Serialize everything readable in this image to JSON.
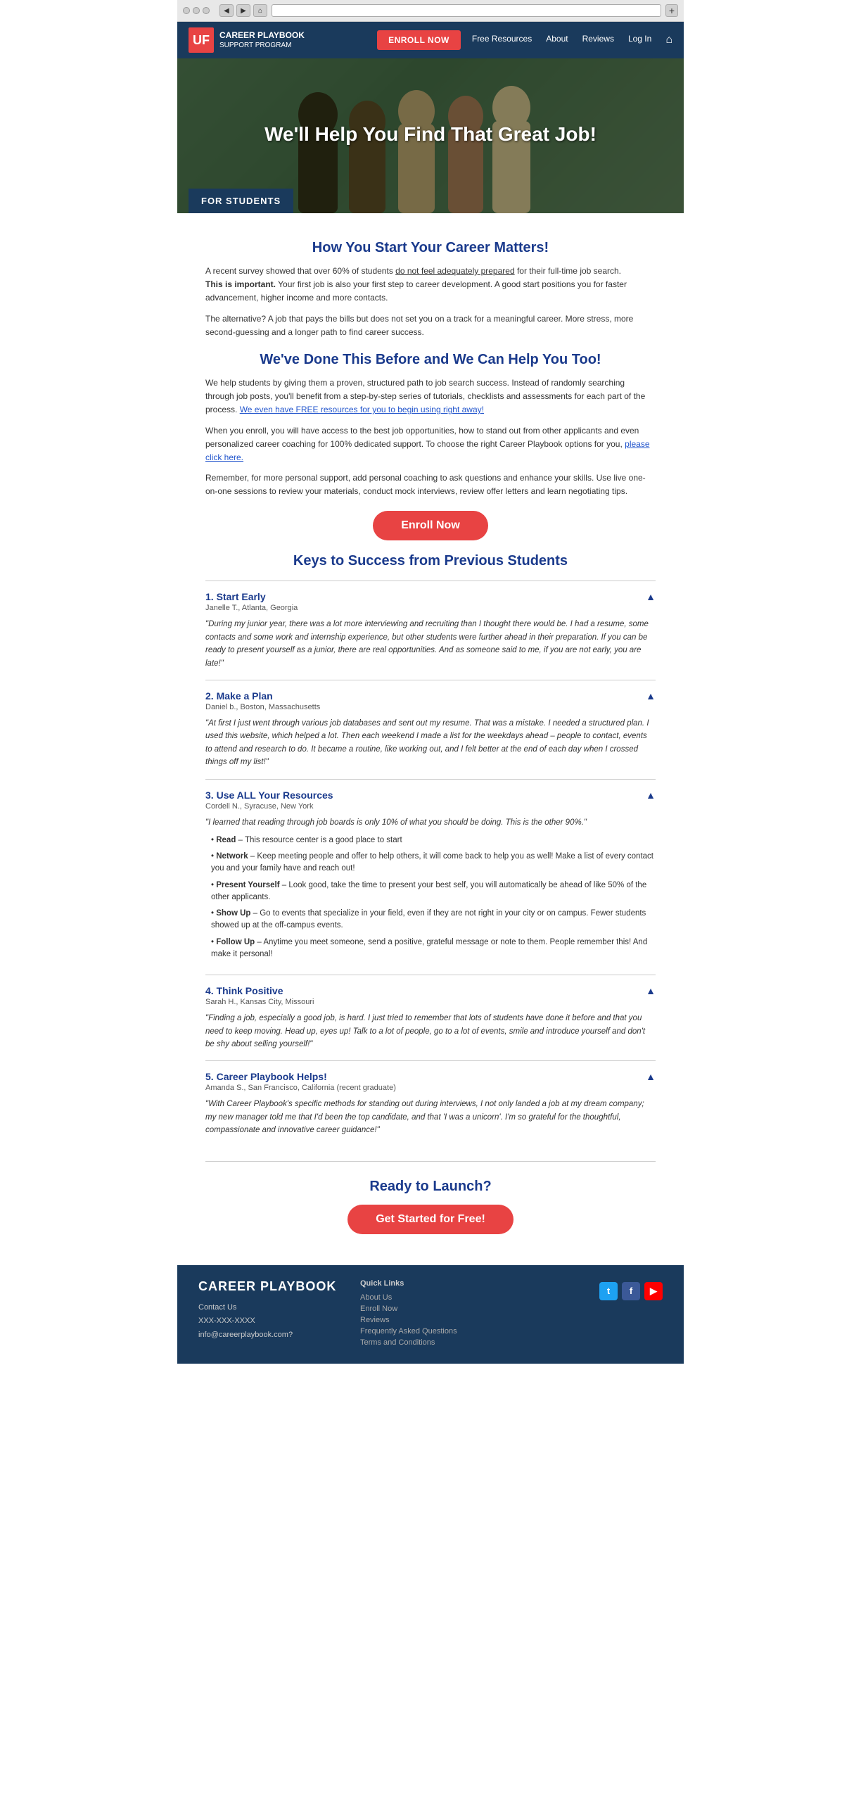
{
  "browser": {
    "address": ""
  },
  "nav": {
    "logo_letters": "UF",
    "logo_line1": "CAREER PLAYBOOK",
    "logo_line2": "SUPPORT PROGRAM",
    "enroll_btn": "ENROLL NOW",
    "links": [
      "Free Resources",
      "About",
      "Reviews",
      "Log In"
    ],
    "home_icon": "⌂"
  },
  "hero": {
    "title": "We'll Help You Find That Great Job!",
    "badge": "FOR STUDENTS"
  },
  "intro": {
    "heading1": "How You Start Your Career Matters!",
    "para1a": "A recent survey showed that over 60% of students ",
    "para1a_underline": "do not feel adequately prepared",
    "para1b": " for their full-time job search.",
    "para2_bold": "This is important.",
    "para2": " Your first job is also your first step to career development. A good start positions you for faster advancement, higher income and more contacts.",
    "para3": "The alternative? A job that pays the bills but does not set you on a track for a meaningful career. More stress, more second-guessing and a longer path to find career success.",
    "heading2": "We've Done This Before and We Can Help You Too!",
    "para4a": "We help students by giving them a proven, structured path to job search success. Instead of randomly searching through job posts, you'll benefit from a step-by-step series of tutorials, checklists and assessments for each part of the process. ",
    "para4_link": "We even have FREE resources for you to begin using right away!",
    "para5a": "When you enroll, you will have access to the best job opportunities, how to stand out from other applicants and even personalized career coaching for 100% dedicated support. To choose the right Career Playbook options for you, ",
    "para5_link": "please click here.",
    "para6": "Remember, for more personal support, add personal coaching to ask questions and enhance your skills. Use live one-on-one sessions to review your materials, conduct mock interviews, review offer letters and learn negotiating tips.",
    "enroll_btn": "Enroll Now"
  },
  "keys": {
    "heading": "Keys to Success from Previous Students",
    "items": [
      {
        "number": "1.",
        "title": "Start Early",
        "person": "Janelle T., Atlanta, Georgia",
        "quote": "\"During my junior year, there was a lot more interviewing and recruiting than I thought there would be. I had a resume, some contacts and some work and internship experience, but other students were further ahead in their preparation. If you can be ready to present yourself as a junior, there are real opportunities. And as someone said to me, if you are not early, you are late!\""
      },
      {
        "number": "2.",
        "title": "Make a Plan",
        "person": "Daniel b., Boston, Massachusetts",
        "quote": "\"At first I just went through various job databases and sent out my resume. That was a mistake. I needed a structured plan. I used this website, which helped a lot. Then each weekend I made a list for the weekdays ahead – people to contact, events to attend and research to do. It became a routine, like working out, and I felt better at the end of each day when I crossed things off my list!\""
      },
      {
        "number": "3.",
        "title": "Use ALL Your Resources",
        "person": "Cordell N., Syracuse, New York",
        "quote": "\"I learned that reading through job boards is only 10% of what you should be doing. This is the other 90%.\"",
        "bullets": [
          {
            "label": "Read",
            "text": " – This resource center is a good place to start"
          },
          {
            "label": "Network",
            "text": " – Keep meeting people and offer to help others, it will come back to help you as well! Make a list of every contact you and your family have and reach out!"
          },
          {
            "label": "Present Yourself",
            "text": " – Look good, take the time to present your best self, you will automatically be ahead of like 50% of the other applicants."
          },
          {
            "label": "Show Up",
            "text": " – Go to events that specialize in your field, even if they are not right in your city or on campus. Fewer students showed up at the off-campus events."
          },
          {
            "label": "Follow Up",
            "text": " – Anytime you meet someone, send a positive, grateful message or note to them. People remember this! And make it personal!"
          }
        ]
      },
      {
        "number": "4.",
        "title": "Think Positive",
        "person": "Sarah H., Kansas City, Missouri",
        "quote": "\"Finding a job, especially a good job, is hard. I just tried to remember that lots of students have done it before and that you need to keep moving. Head up, eyes up! Talk to a lot of people, go to a lot of events, smile and introduce yourself and don't be shy about selling yourself!\""
      },
      {
        "number": "5.",
        "title": "Career Playbook Helps!",
        "person": "Amanda S., San Francisco, California (recent graduate)",
        "quote": "\"With Career Playbook's specific methods for standing out during interviews, I not only landed a job at my dream company; my new manager told me that I'd been the top candidate, and that 'I was a unicorn'. I'm so grateful for the thoughtful, compassionate and innovative career guidance!\""
      }
    ]
  },
  "cta": {
    "heading": "Ready to Launch?",
    "btn": "Get Started for Free!"
  },
  "footer": {
    "logo": "CAREER PLAYBOOK",
    "contact_label": "Contact Us",
    "phone": "XXX-XXX-XXXX",
    "email": "info@careerplaybook.com?",
    "links_heading": "Quick Links",
    "links": [
      "About Us",
      "Enroll Now",
      "Reviews",
      "Frequently Asked Questions",
      "Terms and Conditions"
    ],
    "social": {
      "twitter": "t",
      "facebook": "f",
      "youtube": "▶"
    }
  }
}
